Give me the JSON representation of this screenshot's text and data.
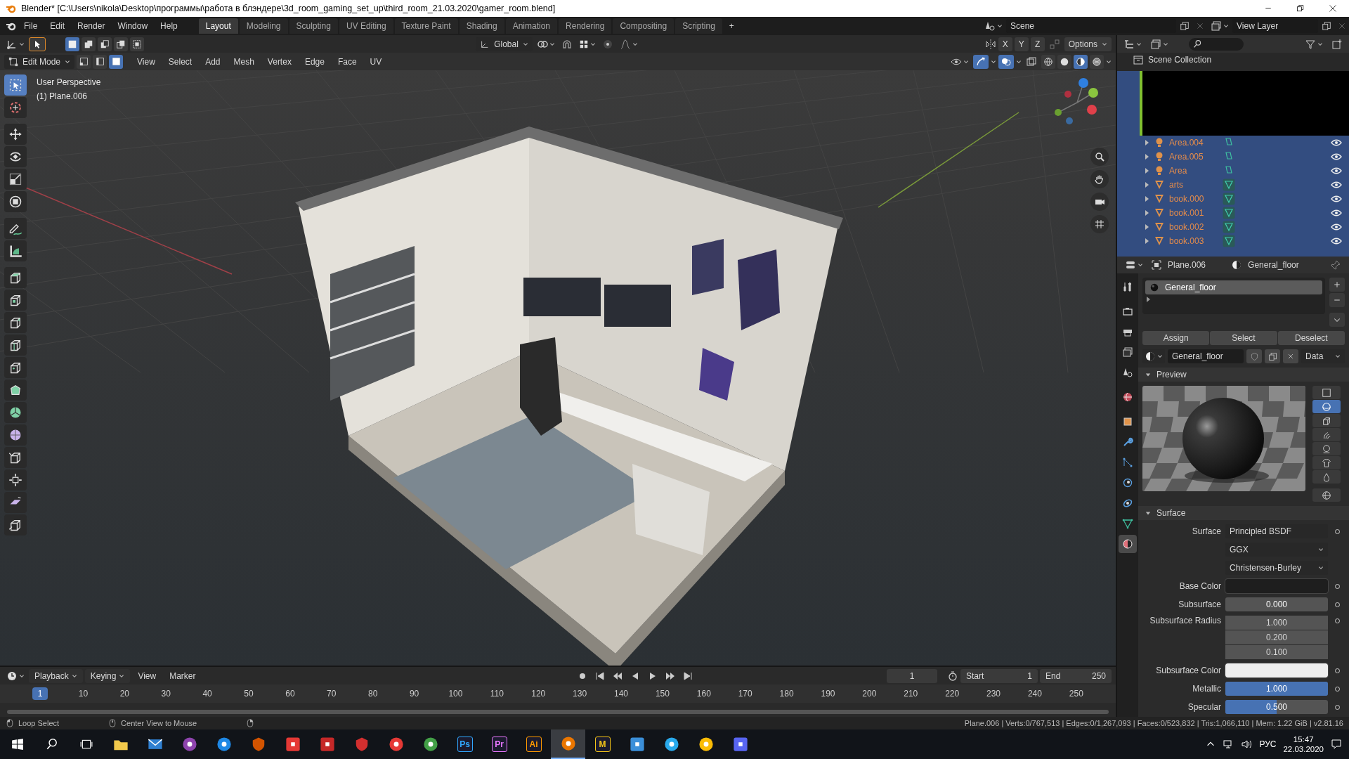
{
  "window": {
    "title": "Blender* [C:\\Users\\nikola\\Desktop\\программы\\работа в блэндере\\3d_room_gaming_set_up\\third_room_21.03.2020\\gamer_room.blend]"
  },
  "menu": [
    "File",
    "Edit",
    "Render",
    "Window",
    "Help"
  ],
  "workspaces": [
    {
      "label": "Layout",
      "selected": true
    },
    {
      "label": "Modeling",
      "selected": false
    },
    {
      "label": "Sculpting",
      "selected": false
    },
    {
      "label": "UV Editing",
      "selected": false
    },
    {
      "label": "Texture Paint",
      "selected": false
    },
    {
      "label": "Shading",
      "selected": false
    },
    {
      "label": "Animation",
      "selected": false
    },
    {
      "label": "Rendering",
      "selected": false
    },
    {
      "label": "Compositing",
      "selected": false
    },
    {
      "label": "Scripting",
      "selected": false
    }
  ],
  "add_workspace": "+",
  "scene": "Scene",
  "view_layer": "View Layer",
  "viewport": {
    "select_modes": [
      {
        "kind": "set",
        "selected": true
      },
      {
        "kind": "extend",
        "selected": false
      },
      {
        "kind": "subtract",
        "selected": false
      },
      {
        "kind": "invert",
        "selected": false
      },
      {
        "kind": "intersect",
        "selected": false
      }
    ],
    "orientation": "Global",
    "mirror_axes": [
      "X",
      "Y",
      "Z"
    ],
    "options": "Options",
    "mode": "Edit Mode",
    "element_modes": [
      {
        "kind": "vertex",
        "selected": false
      },
      {
        "kind": "edge",
        "selected": false
      },
      {
        "kind": "face",
        "selected": true
      }
    ],
    "menus": [
      "View",
      "Select",
      "Add",
      "Mesh",
      "Vertex",
      "Edge",
      "Face",
      "UV"
    ],
    "shading": [
      {
        "kind": "wireframe",
        "selected": false
      },
      {
        "kind": "solid",
        "selected": false
      },
      {
        "kind": "material",
        "selected": true
      },
      {
        "kind": "rendered",
        "selected": false
      }
    ],
    "overlay_text": [
      "User Perspective",
      "(1) Plane.006"
    ],
    "tools": [
      {
        "kind": "select-box",
        "selected": true
      },
      {
        "kind": "cursor",
        "selected": false
      },
      {
        "kind": "move",
        "selected": false
      },
      {
        "kind": "rotate",
        "selected": false
      },
      {
        "kind": "scale",
        "selected": false
      },
      {
        "kind": "transform",
        "selected": false
      },
      {
        "kind": "annotate",
        "selected": false
      },
      {
        "kind": "measure",
        "selected": false
      },
      {
        "kind": "extrude",
        "selected": false
      },
      {
        "kind": "inset",
        "selected": false
      },
      {
        "kind": "bevel",
        "selected": false
      },
      {
        "kind": "loop-cut",
        "selected": false
      },
      {
        "kind": "knife",
        "selected": false
      },
      {
        "kind": "poly-build",
        "selected": false
      },
      {
        "kind": "spin",
        "selected": false
      },
      {
        "kind": "smooth",
        "selected": false
      },
      {
        "kind": "edge-slide",
        "selected": false
      },
      {
        "kind": "shrink",
        "selected": false
      },
      {
        "kind": "shear",
        "selected": false
      },
      {
        "kind": "rip",
        "selected": false
      }
    ]
  },
  "outliner": {
    "root": "Scene Collection",
    "items": [
      {
        "name": "Area.004",
        "kind": "light",
        "selected": true
      },
      {
        "name": "Area.005",
        "kind": "light",
        "selected": true
      },
      {
        "name": "Area",
        "kind": "light",
        "selected": true
      },
      {
        "name": "arts",
        "kind": "mesh",
        "selected": true
      },
      {
        "name": "book.000",
        "kind": "mesh",
        "selected": true
      },
      {
        "name": "book.001",
        "kind": "mesh",
        "selected": true
      },
      {
        "name": "book.002",
        "kind": "mesh",
        "selected": true
      },
      {
        "name": "book.003",
        "kind": "mesh",
        "selected": true
      }
    ]
  },
  "properties": {
    "object": "Plane.006",
    "material": "General_floor",
    "tabs": [
      {
        "kind": "tool",
        "selected": false
      },
      {
        "kind": "render",
        "selected": false
      },
      {
        "kind": "output",
        "selected": false
      },
      {
        "kind": "view_layer",
        "selected": false
      },
      {
        "kind": "scene",
        "selected": false
      },
      {
        "kind": "world",
        "selected": false
      },
      {
        "kind": "object",
        "selected": false
      },
      {
        "kind": "modifier",
        "selected": false
      },
      {
        "kind": "particles",
        "selected": false
      },
      {
        "kind": "physics",
        "selected": false
      },
      {
        "kind": "constraints",
        "selected": false
      },
      {
        "kind": "data",
        "selected": false
      },
      {
        "kind": "material",
        "selected": true
      }
    ],
    "slots": [
      {
        "name": "General_floor",
        "selected": true
      }
    ],
    "slot_buttons": [
      "Assign",
      "Select",
      "Deselect"
    ],
    "material_field": "General_floor",
    "link": "Data",
    "preview_title": "Preview",
    "preview_types": [
      {
        "kind": "flat",
        "selected": false
      },
      {
        "kind": "sphere",
        "selected": true
      },
      {
        "kind": "cube",
        "selected": false
      },
      {
        "kind": "hair",
        "selected": false
      },
      {
        "kind": "shaderball",
        "selected": false
      },
      {
        "kind": "cloth",
        "selected": false
      },
      {
        "kind": "fluid",
        "selected": false
      }
    ],
    "surface_title": "Surface",
    "rows": [
      {
        "kind": "shader",
        "label": "Surface",
        "value": "Principled BSDF"
      },
      {
        "kind": "dropdown",
        "value": "GGX"
      },
      {
        "kind": "dropdown",
        "value": "Christensen-Burley"
      },
      {
        "kind": "color",
        "label": "Base Color",
        "color": "#1e1e1e"
      },
      {
        "kind": "slider",
        "label": "Subsurface",
        "value": "0.000",
        "level": 0
      },
      {
        "kind": "vector",
        "label": "Subsurface Radius",
        "values": [
          "1.000",
          "0.200",
          "0.100"
        ]
      },
      {
        "kind": "color",
        "label": "Subsurface Color",
        "color": "#eeeeee"
      },
      {
        "kind": "slider",
        "label": "Metallic",
        "value": "1.000",
        "level": 1
      },
      {
        "kind": "slider",
        "label": "Specular",
        "value": "0.500",
        "level": 0.5
      }
    ]
  },
  "timeline": {
    "menus": [
      {
        "label": "Playback",
        "dropdown": true
      },
      {
        "label": "Keying",
        "dropdown": true
      },
      {
        "label": "View",
        "dropdown": false
      },
      {
        "label": "Marker",
        "dropdown": false
      }
    ],
    "frame": "1",
    "start_label": "Start",
    "start": "1",
    "end_label": "End",
    "end": "250",
    "current": "1",
    "ticks": [
      "10",
      "20",
      "30",
      "40",
      "50",
      "60",
      "70",
      "80",
      "90",
      "100",
      "110",
      "120",
      "130",
      "140",
      "150",
      "160",
      "170",
      "180",
      "190",
      "200",
      "210",
      "220",
      "230",
      "240",
      "250"
    ]
  },
  "status": {
    "hints": [
      {
        "kind": "left",
        "text": "Loop Select"
      },
      {
        "kind": "middle",
        "text": "Center View to Mouse"
      },
      {
        "kind": "right"
      }
    ],
    "stats": "Plane.006 | Verts:0/767,513 | Edges:0/1,267,093 | Faces:0/523,832 | Tris:1,066,110 | Mem: 1.22 GiB | v2.81.16"
  },
  "taskbar": {
    "apps": [
      {
        "kind": "folder",
        "color": "#f2c94c",
        "selected": false
      },
      {
        "kind": "mail",
        "color": "#2f80d1",
        "selected": false
      },
      {
        "kind": "circle",
        "color": "#8e44ad",
        "selected": false
      },
      {
        "kind": "circle",
        "color": "#1e88e5",
        "selected": false
      },
      {
        "kind": "shield",
        "color": "#d35400",
        "selected": false
      },
      {
        "kind": "square",
        "color": "#e53935",
        "selected": false
      },
      {
        "kind": "square",
        "color": "#c62828",
        "selected": false
      },
      {
        "kind": "shield",
        "color": "#d32f2f",
        "selected": false
      },
      {
        "kind": "circle",
        "color": "#e53935",
        "selected": false
      },
      {
        "kind": "circle",
        "color": "#43a047",
        "selected": false
      },
      {
        "kind": "letter",
        "label": "Ps",
        "color": "#31a8ff",
        "selected": false
      },
      {
        "kind": "letter",
        "label": "Pr",
        "color": "#ea77ff",
        "selected": false
      },
      {
        "kind": "letter",
        "label": "Ai",
        "color": "#ff9a00",
        "selected": false
      },
      {
        "kind": "circle",
        "color": "#ea7600",
        "selected": true
      },
      {
        "kind": "letter",
        "label": "M",
        "color": "#f5c518",
        "selected": false
      },
      {
        "kind": "square",
        "color": "#3b8fd9",
        "selected": false
      },
      {
        "kind": "circle",
        "color": "#29a9eb",
        "selected": false
      },
      {
        "kind": "circle",
        "color": "#fbbc05",
        "selected": false
      },
      {
        "kind": "square",
        "color": "#5865f2",
        "selected": false
      }
    ],
    "language": "РУС",
    "time": "15:47",
    "date": "22.03.2020"
  }
}
